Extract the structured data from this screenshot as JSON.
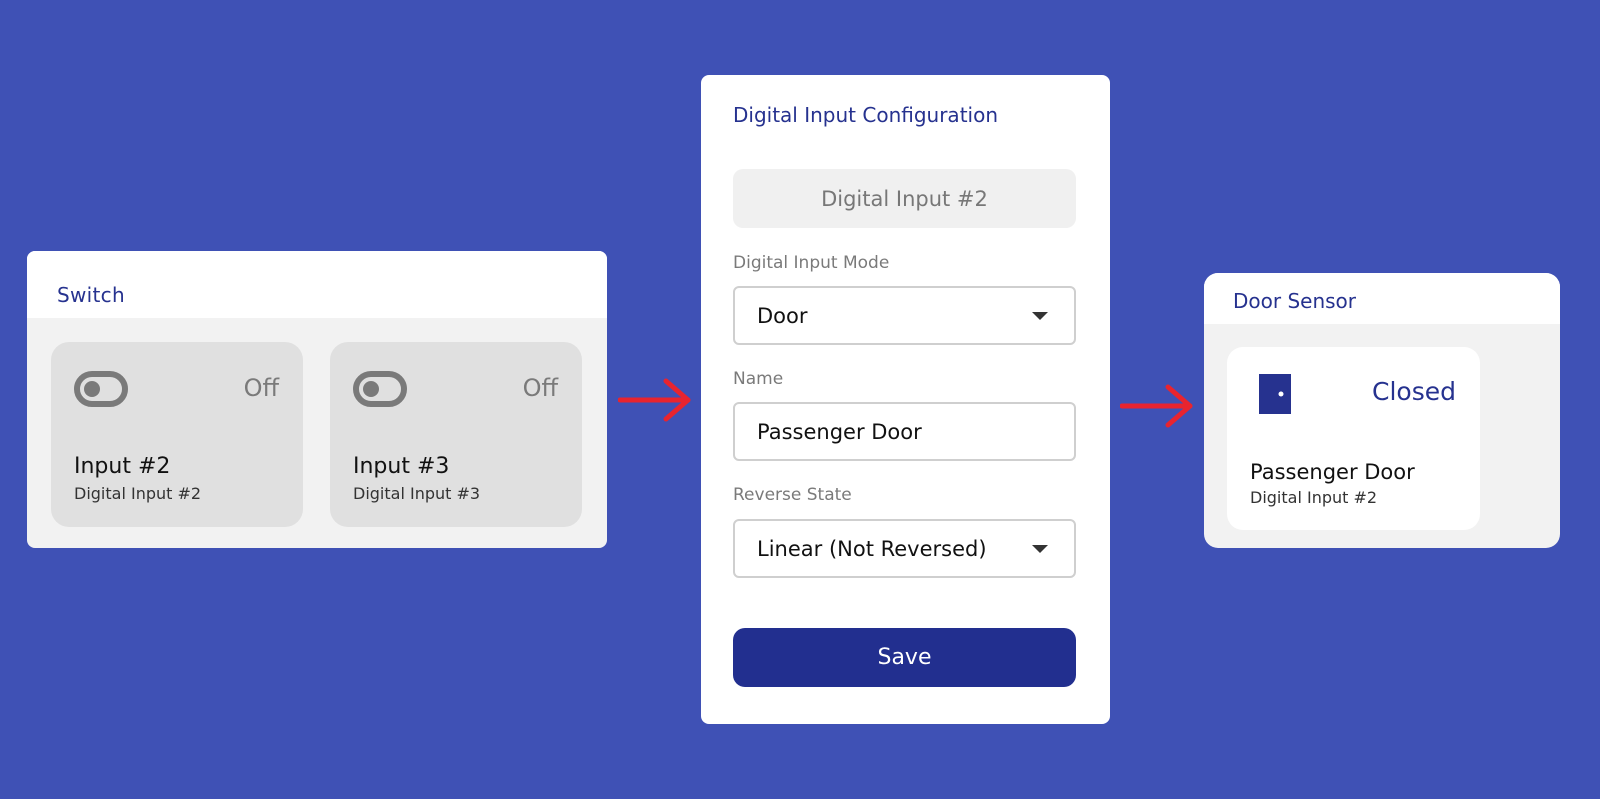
{
  "switch_panel": {
    "title": "Switch",
    "tiles": [
      {
        "state": "Off",
        "name": "Input #2",
        "subtitle": "Digital Input #2",
        "icon": "toggle-off-icon"
      },
      {
        "state": "Off",
        "name": "Input #3",
        "subtitle": "Digital Input #3",
        "icon": "toggle-off-icon"
      }
    ]
  },
  "config_panel": {
    "title": "Digital Input Configuration",
    "input_chip": "Digital Input #2",
    "mode": {
      "label": "Digital Input Mode",
      "value": "Door"
    },
    "name": {
      "label": "Name",
      "value": "Passenger Door"
    },
    "reverse": {
      "label": "Reverse State",
      "value": "Linear (Not Reversed)"
    },
    "save_label": "Save"
  },
  "door_panel": {
    "title": "Door Sensor",
    "state": "Closed",
    "name": "Passenger Door",
    "subtitle": "Digital Input #2",
    "icon": "door-icon"
  },
  "colors": {
    "background": "#3f51b5",
    "accent": "#26328f",
    "button": "#222f8f",
    "arrow": "#e8242f"
  }
}
